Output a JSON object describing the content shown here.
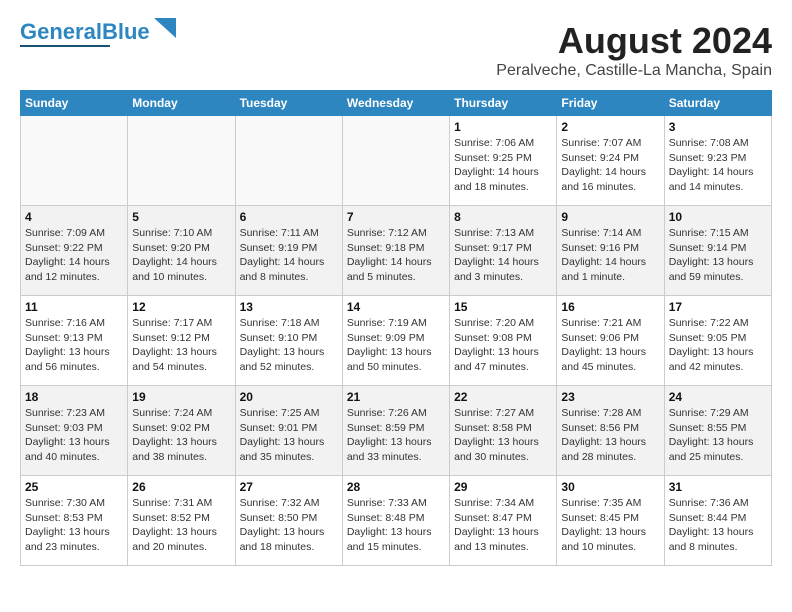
{
  "header": {
    "logo_general": "General",
    "logo_blue": "Blue",
    "month_year": "August 2024",
    "location": "Peralveche, Castille-La Mancha, Spain"
  },
  "days_of_week": [
    "Sunday",
    "Monday",
    "Tuesday",
    "Wednesday",
    "Thursday",
    "Friday",
    "Saturday"
  ],
  "weeks": [
    [
      {
        "day": "",
        "info": ""
      },
      {
        "day": "",
        "info": ""
      },
      {
        "day": "",
        "info": ""
      },
      {
        "day": "",
        "info": ""
      },
      {
        "day": "1",
        "info": "Sunrise: 7:06 AM\nSunset: 9:25 PM\nDaylight: 14 hours\nand 18 minutes."
      },
      {
        "day": "2",
        "info": "Sunrise: 7:07 AM\nSunset: 9:24 PM\nDaylight: 14 hours\nand 16 minutes."
      },
      {
        "day": "3",
        "info": "Sunrise: 7:08 AM\nSunset: 9:23 PM\nDaylight: 14 hours\nand 14 minutes."
      }
    ],
    [
      {
        "day": "4",
        "info": "Sunrise: 7:09 AM\nSunset: 9:22 PM\nDaylight: 14 hours\nand 12 minutes."
      },
      {
        "day": "5",
        "info": "Sunrise: 7:10 AM\nSunset: 9:20 PM\nDaylight: 14 hours\nand 10 minutes."
      },
      {
        "day": "6",
        "info": "Sunrise: 7:11 AM\nSunset: 9:19 PM\nDaylight: 14 hours\nand 8 minutes."
      },
      {
        "day": "7",
        "info": "Sunrise: 7:12 AM\nSunset: 9:18 PM\nDaylight: 14 hours\nand 5 minutes."
      },
      {
        "day": "8",
        "info": "Sunrise: 7:13 AM\nSunset: 9:17 PM\nDaylight: 14 hours\nand 3 minutes."
      },
      {
        "day": "9",
        "info": "Sunrise: 7:14 AM\nSunset: 9:16 PM\nDaylight: 14 hours\nand 1 minute."
      },
      {
        "day": "10",
        "info": "Sunrise: 7:15 AM\nSunset: 9:14 PM\nDaylight: 13 hours\nand 59 minutes."
      }
    ],
    [
      {
        "day": "11",
        "info": "Sunrise: 7:16 AM\nSunset: 9:13 PM\nDaylight: 13 hours\nand 56 minutes."
      },
      {
        "day": "12",
        "info": "Sunrise: 7:17 AM\nSunset: 9:12 PM\nDaylight: 13 hours\nand 54 minutes."
      },
      {
        "day": "13",
        "info": "Sunrise: 7:18 AM\nSunset: 9:10 PM\nDaylight: 13 hours\nand 52 minutes."
      },
      {
        "day": "14",
        "info": "Sunrise: 7:19 AM\nSunset: 9:09 PM\nDaylight: 13 hours\nand 50 minutes."
      },
      {
        "day": "15",
        "info": "Sunrise: 7:20 AM\nSunset: 9:08 PM\nDaylight: 13 hours\nand 47 minutes."
      },
      {
        "day": "16",
        "info": "Sunrise: 7:21 AM\nSunset: 9:06 PM\nDaylight: 13 hours\nand 45 minutes."
      },
      {
        "day": "17",
        "info": "Sunrise: 7:22 AM\nSunset: 9:05 PM\nDaylight: 13 hours\nand 42 minutes."
      }
    ],
    [
      {
        "day": "18",
        "info": "Sunrise: 7:23 AM\nSunset: 9:03 PM\nDaylight: 13 hours\nand 40 minutes."
      },
      {
        "day": "19",
        "info": "Sunrise: 7:24 AM\nSunset: 9:02 PM\nDaylight: 13 hours\nand 38 minutes."
      },
      {
        "day": "20",
        "info": "Sunrise: 7:25 AM\nSunset: 9:01 PM\nDaylight: 13 hours\nand 35 minutes."
      },
      {
        "day": "21",
        "info": "Sunrise: 7:26 AM\nSunset: 8:59 PM\nDaylight: 13 hours\nand 33 minutes."
      },
      {
        "day": "22",
        "info": "Sunrise: 7:27 AM\nSunset: 8:58 PM\nDaylight: 13 hours\nand 30 minutes."
      },
      {
        "day": "23",
        "info": "Sunrise: 7:28 AM\nSunset: 8:56 PM\nDaylight: 13 hours\nand 28 minutes."
      },
      {
        "day": "24",
        "info": "Sunrise: 7:29 AM\nSunset: 8:55 PM\nDaylight: 13 hours\nand 25 minutes."
      }
    ],
    [
      {
        "day": "25",
        "info": "Sunrise: 7:30 AM\nSunset: 8:53 PM\nDaylight: 13 hours\nand 23 minutes."
      },
      {
        "day": "26",
        "info": "Sunrise: 7:31 AM\nSunset: 8:52 PM\nDaylight: 13 hours\nand 20 minutes."
      },
      {
        "day": "27",
        "info": "Sunrise: 7:32 AM\nSunset: 8:50 PM\nDaylight: 13 hours\nand 18 minutes."
      },
      {
        "day": "28",
        "info": "Sunrise: 7:33 AM\nSunset: 8:48 PM\nDaylight: 13 hours\nand 15 minutes."
      },
      {
        "day": "29",
        "info": "Sunrise: 7:34 AM\nSunset: 8:47 PM\nDaylight: 13 hours\nand 13 minutes."
      },
      {
        "day": "30",
        "info": "Sunrise: 7:35 AM\nSunset: 8:45 PM\nDaylight: 13 hours\nand 10 minutes."
      },
      {
        "day": "31",
        "info": "Sunrise: 7:36 AM\nSunset: 8:44 PM\nDaylight: 13 hours\nand 8 minutes."
      }
    ]
  ]
}
